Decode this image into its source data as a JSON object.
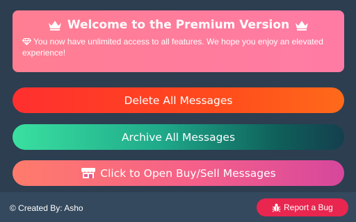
{
  "banner": {
    "title": "Welcome to the Premium Version",
    "message": "You now have unlimited access to all features. We hope you enjoy an elevated experience!",
    "left_icon": "crown-icon",
    "right_icon": "crown-icon",
    "message_icon": "gem-icon"
  },
  "actions": {
    "delete_label": "Delete All Messages",
    "archive_label": "Archive All Messages",
    "buysell_label": "Click to Open Buy/Sell Messages",
    "buysell_icon": "store-icon"
  },
  "footer": {
    "credit": "© Created By: Asho",
    "report_label": "Report a Bug",
    "report_icon": "bug-icon"
  },
  "colors": {
    "background": "#2c3e50",
    "footer": "#34495e",
    "banner": "#ff7e92",
    "report": "#e8264f"
  }
}
